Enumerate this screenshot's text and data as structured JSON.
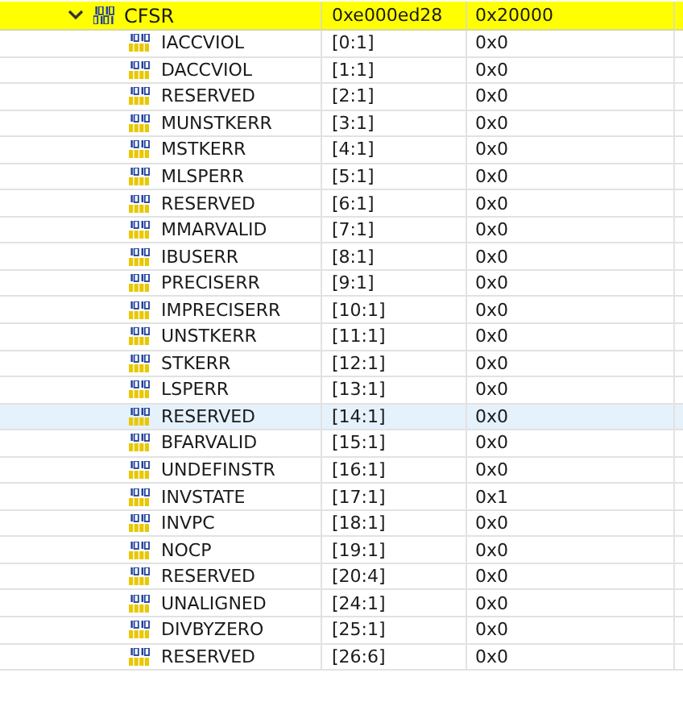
{
  "register": {
    "name": "CFSR",
    "address": "0xe000ed28",
    "value": "0x20000",
    "expanded": true,
    "fields": [
      {
        "name": "IACCVIOL",
        "bits": "[0:1]",
        "value": "0x0",
        "selected": false
      },
      {
        "name": "DACCVIOL",
        "bits": "[1:1]",
        "value": "0x0",
        "selected": false
      },
      {
        "name": "RESERVED",
        "bits": "[2:1]",
        "value": "0x0",
        "selected": false
      },
      {
        "name": "MUNSTKERR",
        "bits": "[3:1]",
        "value": "0x0",
        "selected": false
      },
      {
        "name": "MSTKERR",
        "bits": "[4:1]",
        "value": "0x0",
        "selected": false
      },
      {
        "name": "MLSPERR",
        "bits": "[5:1]",
        "value": "0x0",
        "selected": false
      },
      {
        "name": "RESERVED",
        "bits": "[6:1]",
        "value": "0x0",
        "selected": false
      },
      {
        "name": "MMARVALID",
        "bits": "[7:1]",
        "value": "0x0",
        "selected": false
      },
      {
        "name": "IBUSERR",
        "bits": "[8:1]",
        "value": "0x0",
        "selected": false
      },
      {
        "name": "PRECISERR",
        "bits": "[9:1]",
        "value": "0x0",
        "selected": false
      },
      {
        "name": "IMPRECISERR",
        "bits": "[10:1]",
        "value": "0x0",
        "selected": false
      },
      {
        "name": "UNSTKERR",
        "bits": "[11:1]",
        "value": "0x0",
        "selected": false
      },
      {
        "name": "STKERR",
        "bits": "[12:1]",
        "value": "0x0",
        "selected": false
      },
      {
        "name": "LSPERR",
        "bits": "[13:1]",
        "value": "0x0",
        "selected": false
      },
      {
        "name": "RESERVED",
        "bits": "[14:1]",
        "value": "0x0",
        "selected": true
      },
      {
        "name": "BFARVALID",
        "bits": "[15:1]",
        "value": "0x0",
        "selected": false
      },
      {
        "name": "UNDEFINSTR",
        "bits": "[16:1]",
        "value": "0x0",
        "selected": false
      },
      {
        "name": "INVSTATE",
        "bits": "[17:1]",
        "value": "0x1",
        "selected": false
      },
      {
        "name": "INVPC",
        "bits": "[18:1]",
        "value": "0x0",
        "selected": false
      },
      {
        "name": "NOCP",
        "bits": "[19:1]",
        "value": "0x0",
        "selected": false
      },
      {
        "name": "RESERVED",
        "bits": "[20:4]",
        "value": "0x0",
        "selected": false
      },
      {
        "name": "UNALIGNED",
        "bits": "[24:1]",
        "value": "0x0",
        "selected": false
      },
      {
        "name": "DIVBYZERO",
        "bits": "[25:1]",
        "value": "0x0",
        "selected": false
      },
      {
        "name": "RESERVED",
        "bits": "[26:6]",
        "value": "0x0",
        "selected": false
      }
    ]
  }
}
